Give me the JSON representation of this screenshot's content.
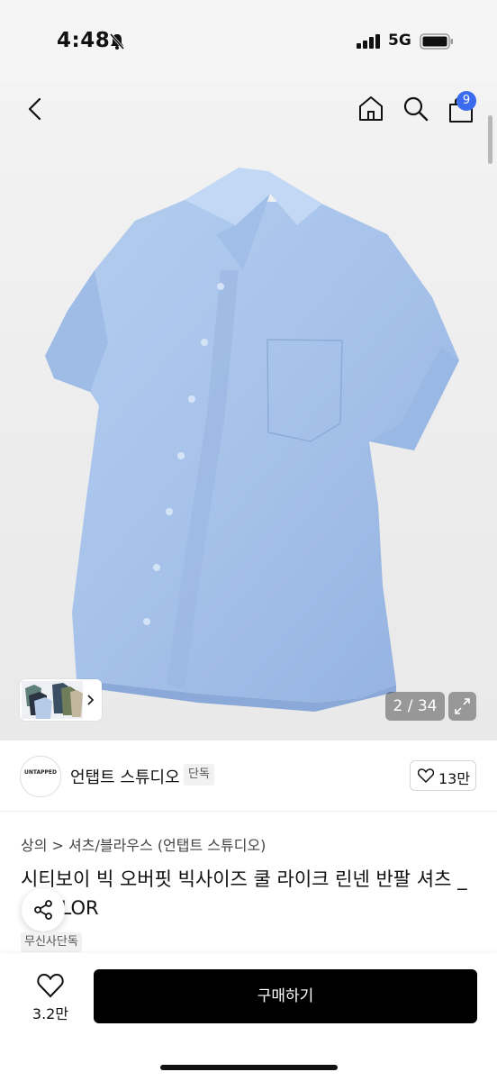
{
  "status_bar": {
    "time": "4:48",
    "network": "5G"
  },
  "nav": {
    "cart_count": "9"
  },
  "gallery": {
    "counter": "2 / 34",
    "shirt_color": "#a9c4ea"
  },
  "brand": {
    "logo_text": "UNTAPPED",
    "name": "언탭트 스튜디오",
    "tag": "단독",
    "likes": "13만"
  },
  "product": {
    "breadcrumb": "상의 > 셔츠/블라우스 (언탭트 스튜디오)",
    "title": "시티보이 빅 오버핏 빅사이즈 쿨 라이크 린넨 반팔 셔츠 _ 4COLOR",
    "exclusive_tag": "무신사단독"
  },
  "bottom": {
    "wish_count": "3.2만",
    "buy_label": "구매하기"
  },
  "colors": {
    "accent": "#3b6cf0",
    "buy_button": "#000000"
  }
}
